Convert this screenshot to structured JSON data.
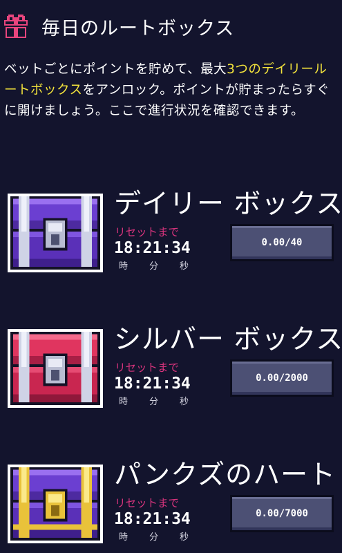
{
  "header": {
    "title": "毎日のルートボックス"
  },
  "intro": {
    "part1": "ベットごとにポイントを貯めて、最大",
    "highlight1": "3つのデイリールートボックス",
    "part2": "をアンロック。ポイントが貯まったらすぐに開けましょう。ここで進行状況を確認できます。"
  },
  "boxes": [
    {
      "title": "デイリー ボックス",
      "reset_label": "リセットまで",
      "timer": "18:21:34",
      "units": [
        "時",
        "分",
        "秒"
      ],
      "progress": "0.00/40",
      "chest_icon": "purple-chest-icon"
    },
    {
      "title": "シルバー ボックス",
      "reset_label": "リセットまで",
      "timer": "18:21:34",
      "units": [
        "時",
        "分",
        "秒"
      ],
      "progress": "0.00/2000",
      "chest_icon": "red-chest-icon"
    },
    {
      "title": "パンクズのハート",
      "reset_label": "リセットまで",
      "timer": "18:21:34",
      "units": [
        "時",
        "分",
        "秒"
      ],
      "progress": "0.00/7000",
      "chest_icon": "gold-purple-chest-icon"
    }
  ],
  "colors": {
    "background": "#13142d",
    "highlight": "#f3e33c",
    "reset_label": "#d9347d",
    "button": "#4c5074"
  }
}
